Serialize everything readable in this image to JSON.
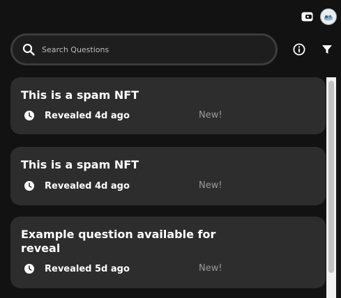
{
  "header": {
    "wallet_icon": "wallet-icon",
    "avatar_icon": "avatar"
  },
  "search": {
    "placeholder": "Search Questions",
    "value": ""
  },
  "toolbar": {
    "info_icon": "info-icon",
    "filter_icon": "filter-icon"
  },
  "questions": [
    {
      "title": "This is a spam NFT",
      "revealed": "Revealed 4d ago",
      "badge": "New!"
    },
    {
      "title": "This is a spam NFT",
      "revealed": "Revealed 4d ago",
      "badge": "New!"
    },
    {
      "title": "Example question available for reveal",
      "revealed": "Revealed 5d ago",
      "badge": "New!"
    }
  ],
  "colors": {
    "background": "#121212",
    "card": "#2d2d2d",
    "muted_text": "#9a9a9a",
    "search_border": "#3c3c3c"
  }
}
